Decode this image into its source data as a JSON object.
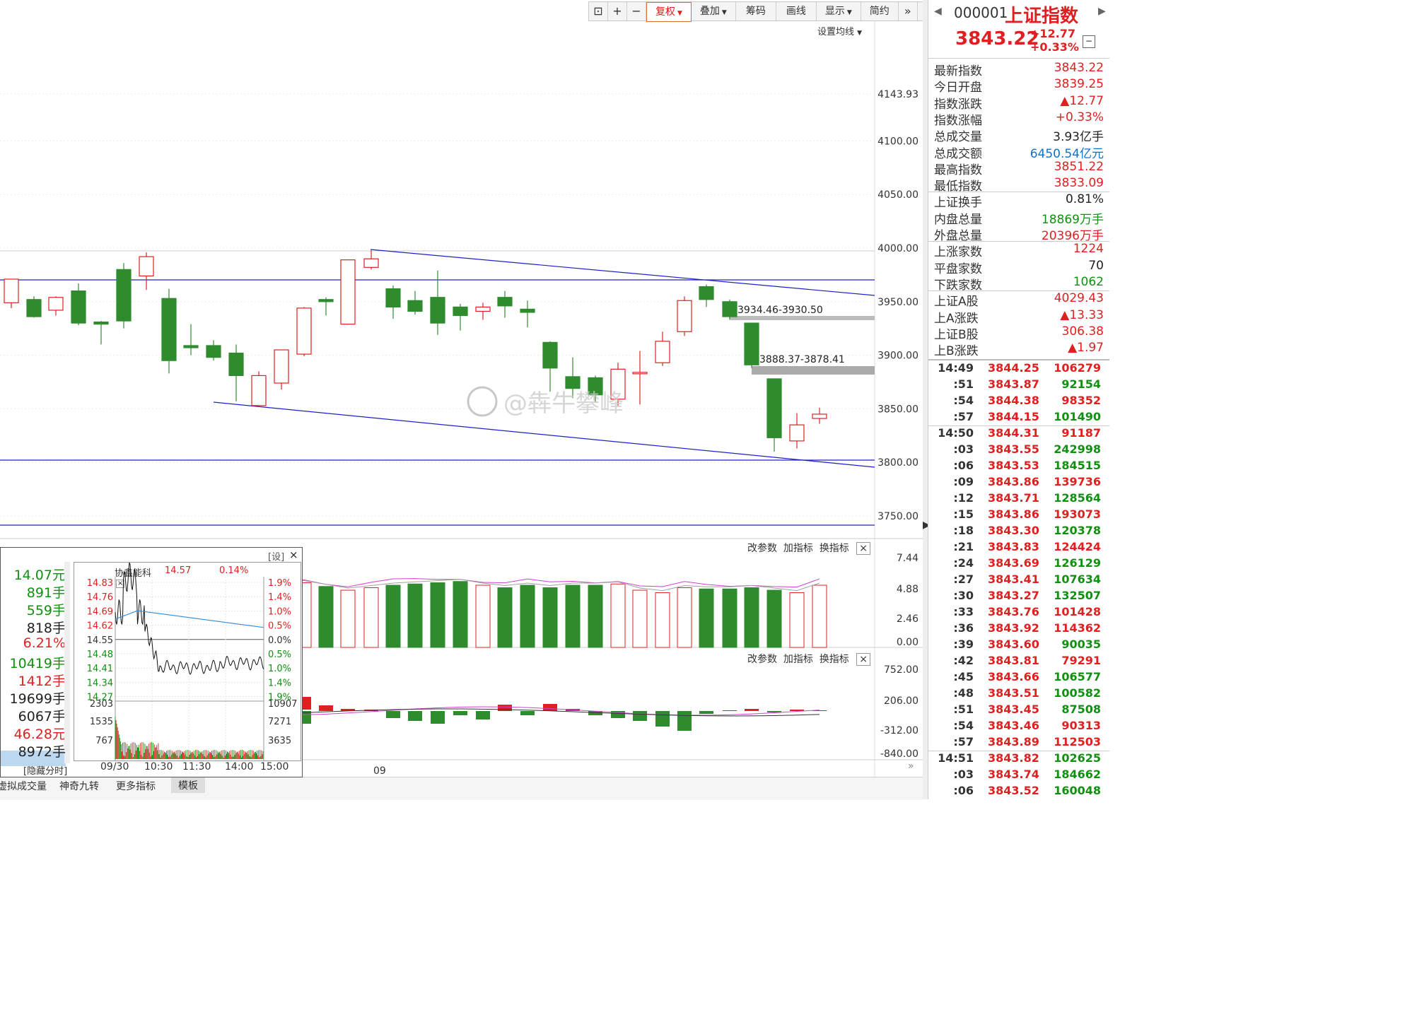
{
  "toolbar": {
    "fuquan": "复权",
    "diejia": "叠加",
    "chouma": "筹码",
    "huaxian": "画线",
    "xianshi": "显示",
    "jianyue": "简约",
    "set_ma": "设置均线"
  },
  "chart": {
    "y_ticks": [
      "4143.93",
      "4100.00",
      "4050.00",
      "4000.00",
      "3950.00",
      "3900.00",
      "3850.00",
      "3800.00",
      "3750.00"
    ],
    "gap1": "3934.46-3930.50",
    "gap2": "3888.37-3878.41",
    "x_label": "09",
    "watermark": "@犇牛攀峰"
  },
  "panel_buttons": {
    "gaicanshu": "改参数",
    "jiazhibiao": "加指标",
    "huanzhibiao": "换指标"
  },
  "vol_ticks": [
    "7.44",
    "4.88",
    "2.46",
    "0.00"
  ],
  "macd_ticks": [
    "752.00",
    "206.00",
    "-312.00",
    "-840.00"
  ],
  "bottom_tabs": [
    "虚拟成交量",
    "神奇九转",
    "更多指标",
    "模板"
  ],
  "index": {
    "code": "000001",
    "name": "上证指数",
    "price": "3843.22",
    "change": "+12.77",
    "pct": "+0.33%"
  },
  "stats": [
    {
      "k": "最新指数",
      "v": "3843.22",
      "c": "red"
    },
    {
      "k": "今日开盘",
      "v": "3839.25",
      "c": "red"
    },
    {
      "k": "指数涨跌",
      "v": "▲12.77",
      "c": "red"
    },
    {
      "k": "指数涨幅",
      "v": "+0.33%",
      "c": "red"
    },
    {
      "k": "总成交量",
      "v": "3.93亿手",
      "c": "blk"
    },
    {
      "k": "总成交额",
      "v": "6450.54亿元",
      "c": "blue"
    },
    {
      "k": "最高指数",
      "v": "3851.22",
      "c": "red"
    },
    {
      "k": "最低指数",
      "v": "3833.09",
      "c": "red"
    },
    {
      "k": "上证换手",
      "v": "0.81%",
      "c": "blk"
    },
    {
      "k": "内盘总量",
      "v": "18869万手",
      "c": "green"
    },
    {
      "k": "外盘总量",
      "v": "20396万手",
      "c": "red"
    },
    {
      "k": "上涨家数",
      "v": "1224",
      "c": "red"
    },
    {
      "k": "平盘家数",
      "v": "70",
      "c": "blk"
    },
    {
      "k": "下跌家数",
      "v": "1062",
      "c": "green"
    },
    {
      "k": "上证A股",
      "v": "4029.43",
      "c": "red"
    },
    {
      "k": "上A涨跌",
      "v": "▲13.33",
      "c": "red"
    },
    {
      "k": "上证B股",
      "v": "306.38",
      "c": "red"
    },
    {
      "k": "上B涨跌",
      "v": "▲1.97",
      "c": "red"
    }
  ],
  "ticks": [
    {
      "t": "14:49",
      "p": "3844.25",
      "v": "106279",
      "c": "red"
    },
    {
      "t": ":51",
      "p": "3843.87",
      "v": "92154",
      "c": "green"
    },
    {
      "t": ":54",
      "p": "3844.38",
      "v": "98352",
      "c": "red"
    },
    {
      "t": ":57",
      "p": "3844.15",
      "v": "101490",
      "c": "green"
    },
    {
      "t": "14:50",
      "p": "3844.31",
      "v": "91187",
      "c": "red"
    },
    {
      "t": ":03",
      "p": "3843.55",
      "v": "242998",
      "c": "green"
    },
    {
      "t": ":06",
      "p": "3843.53",
      "v": "184515",
      "c": "green"
    },
    {
      "t": ":09",
      "p": "3843.86",
      "v": "139736",
      "c": "red"
    },
    {
      "t": ":12",
      "p": "3843.71",
      "v": "128564",
      "c": "green"
    },
    {
      "t": ":15",
      "p": "3843.86",
      "v": "193073",
      "c": "red"
    },
    {
      "t": ":18",
      "p": "3843.30",
      "v": "120378",
      "c": "green"
    },
    {
      "t": ":21",
      "p": "3843.83",
      "v": "124424",
      "c": "red"
    },
    {
      "t": ":24",
      "p": "3843.69",
      "v": "126129",
      "c": "green"
    },
    {
      "t": ":27",
      "p": "3843.41",
      "v": "107634",
      "c": "green"
    },
    {
      "t": ":30",
      "p": "3843.27",
      "v": "132507",
      "c": "green"
    },
    {
      "t": ":33",
      "p": "3843.76",
      "v": "101428",
      "c": "red"
    },
    {
      "t": ":36",
      "p": "3843.92",
      "v": "114362",
      "c": "red"
    },
    {
      "t": ":39",
      "p": "3843.60",
      "v": "90035",
      "c": "green"
    },
    {
      "t": ":42",
      "p": "3843.81",
      "v": "79291",
      "c": "red"
    },
    {
      "t": ":45",
      "p": "3843.66",
      "v": "106577",
      "c": "green"
    },
    {
      "t": ":48",
      "p": "3843.51",
      "v": "100582",
      "c": "green"
    },
    {
      "t": ":51",
      "p": "3843.45",
      "v": "87508",
      "c": "green"
    },
    {
      "t": ":54",
      "p": "3843.46",
      "v": "90313",
      "c": "red"
    },
    {
      "t": ":57",
      "p": "3843.89",
      "v": "112503",
      "c": "red"
    },
    {
      "t": "14:51",
      "p": "3843.82",
      "v": "102625",
      "c": "green"
    },
    {
      "t": ":03",
      "p": "3843.74",
      "v": "184662",
      "c": "green"
    },
    {
      "t": ":06",
      "p": "3843.52",
      "v": "160048",
      "c": "green"
    }
  ],
  "popup": {
    "left_vals": [
      {
        "v": "14.07元",
        "c": "green"
      },
      {
        "v": "891手",
        "c": "green"
      },
      {
        "v": "559手",
        "c": "green"
      },
      {
        "v": "818手",
        "c": "blk"
      },
      {
        "v": "6.21%",
        "c": "red"
      },
      {
        "v": "10419手",
        "c": "green"
      },
      {
        "v": "1412手",
        "c": "red"
      },
      {
        "v": "19699手",
        "c": "blk"
      },
      {
        "v": "6067手",
        "c": "blk"
      },
      {
        "v": "46.28元",
        "c": "red"
      },
      {
        "v": "8972手",
        "c": "blk"
      }
    ],
    "hide_label": "[隐藏分时]",
    "set_label": "[设]",
    "close": "×",
    "stock_name": "协鑫能科",
    "stock_price": "14.57",
    "stock_pct": "0.14%",
    "price_ticks": [
      "14.83",
      "14.76",
      "14.69",
      "14.62",
      "14.55",
      "14.48",
      "14.41",
      "14.34",
      "14.27"
    ],
    "pct_ticks": [
      "1.9%",
      "1.4%",
      "1.0%",
      "0.5%",
      "0.0%",
      "0.5%",
      "1.0%",
      "1.4%",
      "1.9%"
    ],
    "vol_left": [
      "2303",
      "1535",
      "767"
    ],
    "vol_right": [
      "10907",
      "7271",
      "3635"
    ],
    "times": [
      "09/30",
      "10:30",
      "11:30",
      "14:00",
      "15:00"
    ]
  }
}
